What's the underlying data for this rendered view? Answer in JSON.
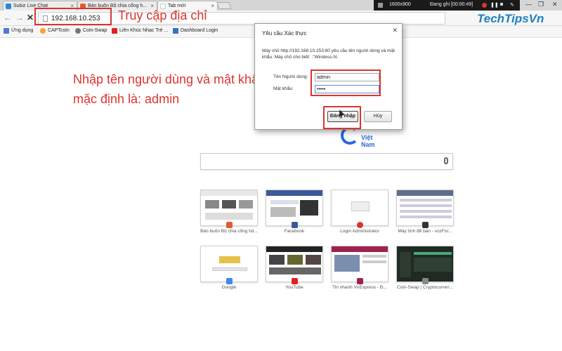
{
  "tabs": [
    {
      "label": "Subiz Live Chat",
      "favicon_color": "#2a87d6"
    },
    {
      "label": "Bán buôn Bộ chia cổng h...",
      "favicon_color": "#e45a30"
    },
    {
      "label": "Tab mới",
      "favicon_color": "#ffffff"
    }
  ],
  "recorder": {
    "resolution": "1600x900",
    "status": "Đang ghi [00:00:49]"
  },
  "address": {
    "url": "192.168.10.253"
  },
  "annotations": {
    "url_hint": "Truy cập địa chỉ",
    "credentials_hint": "Nhập tên người dùng và mật khẩu mặc định là: admin"
  },
  "brand": {
    "watermark": "TechTipsVn",
    "color": "#1e7fc2"
  },
  "bookmarks": [
    {
      "label": "Ứng dụng",
      "icon": "apps-grid-icon",
      "color": "#4a7bd6"
    },
    {
      "label": "CAPTcoin",
      "icon": "captcoin-icon",
      "color": "#f2a533"
    },
    {
      "label": "Coin-Swap",
      "icon": "coinswap-icon",
      "color": "#777777"
    },
    {
      "label": "Liên Khúc Nhạc Trẻ ...",
      "icon": "youtube-icon",
      "color": "#e02020"
    },
    {
      "label": "Dashboard Login",
      "icon": "dashboard-icon",
      "color": "#3b6fc4"
    }
  ],
  "google": {
    "region": "Việt Nam"
  },
  "most_visited": [
    {
      "label": "Bán buôn Bộ chia cổng hd...",
      "icon_color": "#e45a30",
      "theme": "#e8e8e8"
    },
    {
      "label": "Facebook",
      "icon_color": "#3b5998",
      "theme": "#3b5998"
    },
    {
      "label": "Login Administrator",
      "icon_color": "#d9352f",
      "theme": "#ffffff"
    },
    {
      "label": "Máy tính để bàn - vozFor...",
      "icon_color": "#333333",
      "theme": "#5c6f8a"
    },
    {
      "label": "Google",
      "icon_color": "#4285f4",
      "theme": "#ffffff"
    },
    {
      "label": "YouTube",
      "icon_color": "#e02020",
      "theme": "#222222"
    },
    {
      "label": "Tin nhanh VnExpress - Đ...",
      "icon_color": "#9f224e",
      "theme": "#9f224e"
    },
    {
      "label": "Coin-Swap | Cryptocurren...",
      "icon_color": "#888888",
      "theme": "#1f2a22"
    }
  ],
  "auth_dialog": {
    "title": "Yêu cầu Xác thực",
    "message": "Máy chủ http://192.168.10.253:80 yêu cầu tên người dùng và mật khẩu. Máy chủ cho biết: .\"Wireless-N.",
    "username_label": "Tên Người dùng:",
    "username_value": "admin",
    "password_label": "Mật khẩu:",
    "password_value": "•••••",
    "login_button": "Đăng nhập",
    "cancel_button": "Hủy"
  }
}
